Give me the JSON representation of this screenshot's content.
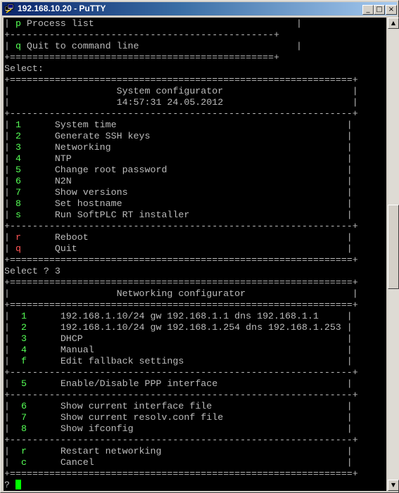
{
  "window": {
    "title": "192.168.10.20 - PuTTY",
    "controls": {
      "minimize": "_",
      "maximize": "□",
      "close": "×"
    }
  },
  "colors": {
    "terminal_bg": "#000000",
    "text": "#bbbbbb",
    "green": "#55ff55",
    "red": "#ff5555",
    "cursor": "#00ff00"
  },
  "terminal": {
    "lines": [
      [
        {
          "t": "| "
        },
        {
          "t": "p",
          "c": "g"
        },
        {
          "t": " Process list                                    |"
        }
      ],
      [
        {
          "t": "+-----------------------------------------------+"
        }
      ],
      [
        {
          "t": "| "
        },
        {
          "t": "q",
          "c": "g"
        },
        {
          "t": " Quit to command line                            |"
        }
      ],
      [
        {
          "t": "+===============================================+"
        }
      ],
      [
        {
          "t": "Select:"
        }
      ],
      [
        {
          "t": "+=============================================================+"
        }
      ],
      [
        {
          "t": "|                   System configurator                       |"
        }
      ],
      [
        {
          "t": "|                   14:57:31 24.05.2012                       |"
        }
      ],
      [
        {
          "t": "+-------------------------------------------------------------+"
        }
      ],
      [
        {
          "t": "| "
        },
        {
          "t": "1",
          "c": "g"
        },
        {
          "t": "      System time                                         |"
        }
      ],
      [
        {
          "t": "| "
        },
        {
          "t": "2",
          "c": "g"
        },
        {
          "t": "      Generate SSH keys                                   |"
        }
      ],
      [
        {
          "t": "| "
        },
        {
          "t": "3",
          "c": "g"
        },
        {
          "t": "      Networking                                          |"
        }
      ],
      [
        {
          "t": "| "
        },
        {
          "t": "4",
          "c": "g"
        },
        {
          "t": "      NTP                                                 |"
        }
      ],
      [
        {
          "t": "| "
        },
        {
          "t": "5",
          "c": "g"
        },
        {
          "t": "      Change root password                                |"
        }
      ],
      [
        {
          "t": "| "
        },
        {
          "t": "6",
          "c": "g"
        },
        {
          "t": "      N2N                                                 |"
        }
      ],
      [
        {
          "t": "| "
        },
        {
          "t": "7",
          "c": "g"
        },
        {
          "t": "      Show versions                                       |"
        }
      ],
      [
        {
          "t": "| "
        },
        {
          "t": "8",
          "c": "g"
        },
        {
          "t": "      Set hostname                                        |"
        }
      ],
      [
        {
          "t": "| "
        },
        {
          "t": "s",
          "c": "g"
        },
        {
          "t": "      Run SoftPLC RT installer                            |"
        }
      ],
      [
        {
          "t": "+-------------------------------------------------------------+"
        }
      ],
      [
        {
          "t": "| "
        },
        {
          "t": "r",
          "c": "r"
        },
        {
          "t": "      Reboot                                              |"
        }
      ],
      [
        {
          "t": "| "
        },
        {
          "t": "q",
          "c": "r"
        },
        {
          "t": "      Quit                                                |"
        }
      ],
      [
        {
          "t": "+=============================================================+"
        }
      ],
      [
        {
          "t": "Select ? 3"
        }
      ],
      [
        {
          "t": "+=============================================================+"
        }
      ],
      [
        {
          "t": "|                   Networking configurator                   |"
        }
      ],
      [
        {
          "t": "+=============================================================+"
        }
      ],
      [
        {
          "t": "|  "
        },
        {
          "t": "1",
          "c": "g"
        },
        {
          "t": "      192.168.1.10/24 gw 192.168.1.1 dns 192.168.1.1     |"
        }
      ],
      [
        {
          "t": "|  "
        },
        {
          "t": "2",
          "c": "g"
        },
        {
          "t": "      192.168.1.10/24 gw 192.168.1.254 dns 192.168.1.253 |"
        }
      ],
      [
        {
          "t": "|  "
        },
        {
          "t": "3",
          "c": "g"
        },
        {
          "t": "      DHCP                                               |"
        }
      ],
      [
        {
          "t": "|  "
        },
        {
          "t": "4",
          "c": "g"
        },
        {
          "t": "      Manual                                             |"
        }
      ],
      [
        {
          "t": "|  "
        },
        {
          "t": "f",
          "c": "g"
        },
        {
          "t": "      Edit fallback settings                             |"
        }
      ],
      [
        {
          "t": "+-------------------------------------------------------------+"
        }
      ],
      [
        {
          "t": "|  "
        },
        {
          "t": "5",
          "c": "g"
        },
        {
          "t": "      Enable/Disable PPP interface                       |"
        }
      ],
      [
        {
          "t": "+-------------------------------------------------------------+"
        }
      ],
      [
        {
          "t": "|  "
        },
        {
          "t": "6",
          "c": "g"
        },
        {
          "t": "      Show current interface file                        |"
        }
      ],
      [
        {
          "t": "|  "
        },
        {
          "t": "7",
          "c": "g"
        },
        {
          "t": "      Show current resolv.conf file                      |"
        }
      ],
      [
        {
          "t": "|  "
        },
        {
          "t": "8",
          "c": "g"
        },
        {
          "t": "      Show ifconfig                                      |"
        }
      ],
      [
        {
          "t": "+-------------------------------------------------------------+"
        }
      ],
      [
        {
          "t": "|  "
        },
        {
          "t": "r",
          "c": "g"
        },
        {
          "t": "      Restart networking                                 |"
        }
      ],
      [
        {
          "t": "|  "
        },
        {
          "t": "c",
          "c": "g"
        },
        {
          "t": "      Cancel                                             |"
        }
      ],
      [
        {
          "t": "+=============================================================+"
        }
      ],
      [
        {
          "t": "? "
        }
      ]
    ]
  },
  "scrollbar": {
    "up_arrow": "▲",
    "down_arrow": "▼"
  }
}
